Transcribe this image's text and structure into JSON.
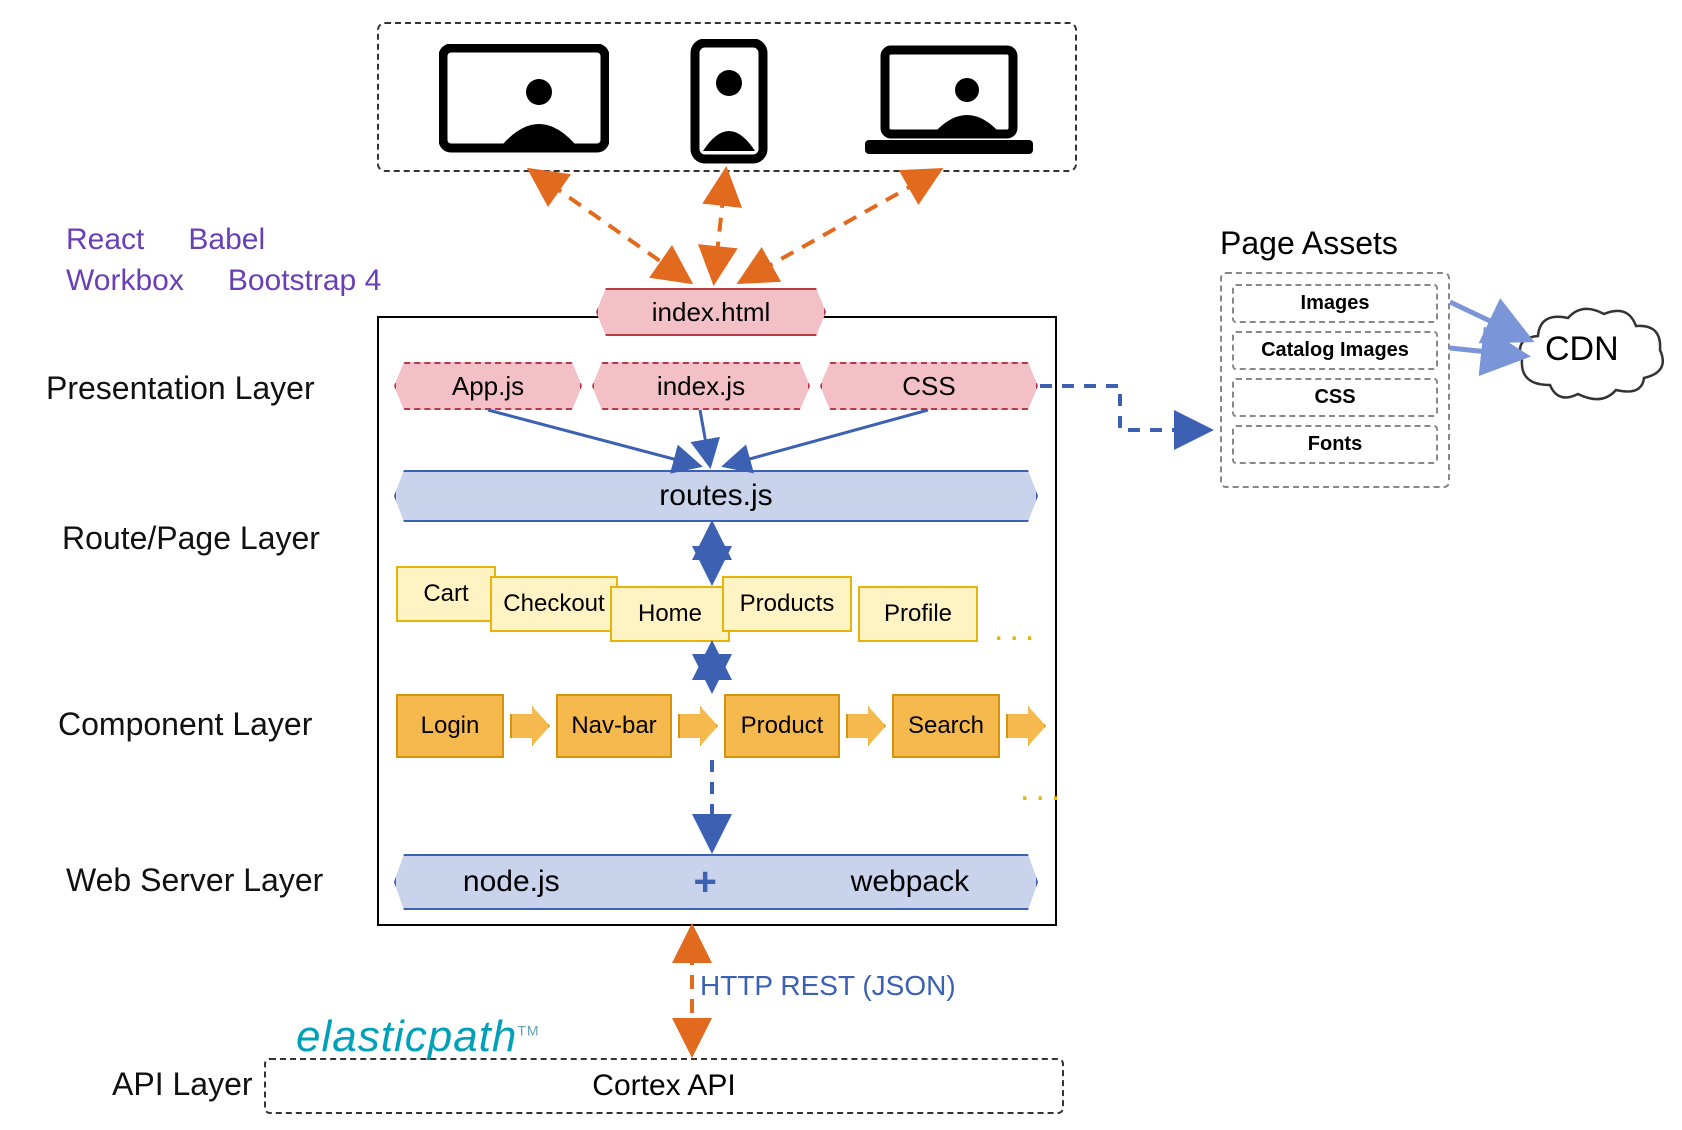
{
  "tech_labels": {
    "react": "React",
    "babel": "Babel",
    "workbox": "Workbox",
    "bootstrap": "Bootstrap 4"
  },
  "layer_labels": {
    "presentation": "Presentation Layer",
    "routepage": "Route/Page Layer",
    "component": "Component Layer",
    "webserver": "Web Server Layer",
    "api": "API Layer"
  },
  "entry_file": "index.html",
  "presentation_files": {
    "app": "App.js",
    "index": "index.js",
    "css": "CSS"
  },
  "routes_file": "routes.js",
  "routes": [
    "Cart",
    "Checkout",
    "Home",
    "Products",
    "Profile"
  ],
  "components": [
    "Login",
    "Nav-bar",
    "Product",
    "Search"
  ],
  "web_server": {
    "left": "node.js",
    "right": "webpack"
  },
  "rest_label": "HTTP REST (JSON)",
  "brand": "elasticpath",
  "brand_tm": "TM",
  "api_box": "Cortex API",
  "assets": {
    "title": "Page Assets",
    "items": [
      "Images",
      "Catalog Images",
      "CSS",
      "Fonts"
    ]
  },
  "cdn": "CDN"
}
